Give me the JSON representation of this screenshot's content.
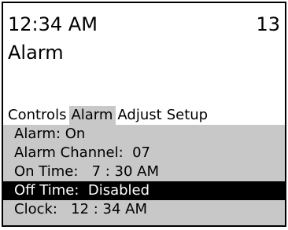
{
  "status": {
    "time": "12:34 AM",
    "channel": "13"
  },
  "mode_title": "Alarm",
  "tabs": [
    {
      "label": "Controls",
      "active": false
    },
    {
      "label": "Alarm",
      "active": true
    },
    {
      "label": "Adjust",
      "active": false
    },
    {
      "label": "Setup",
      "active": false
    }
  ],
  "menu": {
    "items": [
      {
        "label": "Alarm: On"
      },
      {
        "label": "Alarm Channel:  07"
      },
      {
        "label": "On Time:   7 : 30 AM"
      },
      {
        "label": "Off Time:  Disabled",
        "selected": true
      },
      {
        "label": "Clock:   12 : 34 AM"
      }
    ]
  },
  "colors": {
    "highlight": "#c8c8c8",
    "selected_background": "#000000",
    "selected_text": "#ffffff"
  }
}
